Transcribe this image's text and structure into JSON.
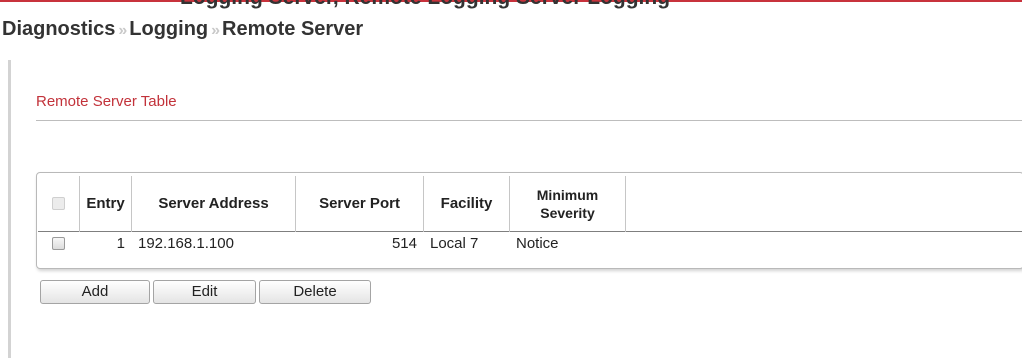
{
  "top_cutoff": {
    "text": "Logging Server, Remote Logging Server Logging"
  },
  "breadcrumb": {
    "items": [
      "Diagnostics",
      "Logging",
      "Remote Server"
    ],
    "separator": "»"
  },
  "section": {
    "title": "Remote Server Table"
  },
  "table": {
    "headers": {
      "entry": "Entry",
      "server_address": "Server Address",
      "server_port": "Server Port",
      "facility": "Facility",
      "min_severity_line1": "Minimum",
      "min_severity_line2": "Severity"
    },
    "rows": [
      {
        "entry": "1",
        "server_address": "192.168.1.100",
        "server_port": "514",
        "facility": "Local 7",
        "min_severity": "Notice",
        "selected": false
      }
    ]
  },
  "buttons": {
    "add": "Add",
    "edit": "Edit",
    "delete": "Delete"
  },
  "colors": {
    "accent_red": "#c2323a",
    "text": "#222222"
  },
  "icons": {
    "breadcrumb_separator": "double-chevron-right-icon",
    "row_select": "checkbox-icon"
  }
}
